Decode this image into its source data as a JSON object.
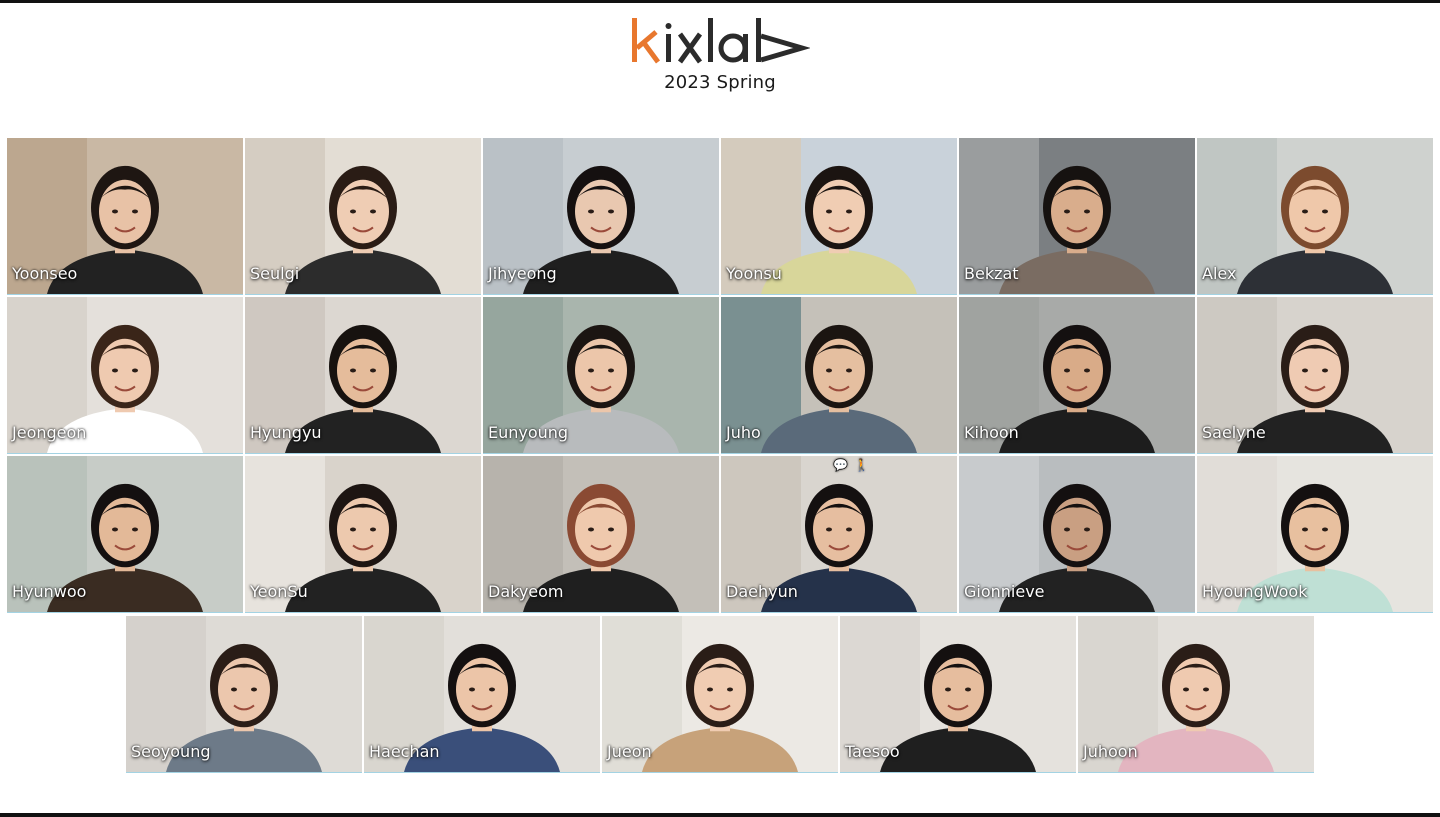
{
  "header": {
    "logo_text": "kixlab",
    "subtitle": "2023 Spring",
    "brand_orange": "#e8772e",
    "brand_dark": "#2b2b2b"
  },
  "participants": [
    {
      "name": "Yoonseo",
      "bg": "#c9b8a4",
      "wall": "#b79f86",
      "skin": "#e8c2a6",
      "hair": "#1e1612",
      "shirt": "#222222"
    },
    {
      "name": "Seulgi",
      "bg": "#e3ddd4",
      "wall": "#cfc6bb",
      "skin": "#efcdb4",
      "hair": "#2a1c15",
      "shirt": "#2c2c2c"
    },
    {
      "name": "Jihyeong",
      "bg": "#c7cdd1",
      "wall": "#b5bcc2",
      "skin": "#e9c8b0",
      "hair": "#151010",
      "shirt": "#1f1f1f"
    },
    {
      "name": "Yoonsu",
      "bg": "#c9d2da",
      "wall": "#d8c7b0",
      "skin": "#f0cdb3",
      "hair": "#1b1411",
      "shirt": "#d8d69a"
    },
    {
      "name": "Bekzat",
      "bg": "#7b7f82",
      "wall": "#a8aaa9",
      "skin": "#d9ad8c",
      "hair": "#161210",
      "shirt": "#7a6c62"
    },
    {
      "name": "Alex",
      "bg": "#cfd2cf",
      "wall": "#b9c1bd",
      "skin": "#efc8aa",
      "hair": "#7c4b2e",
      "shirt": "#2d3036"
    },
    {
      "name": "Jeongeon",
      "bg": "#e4e0db",
      "wall": "#d3cdc6",
      "skin": "#efcab0",
      "hair": "#3a2519",
      "shirt": "#ffffff"
    },
    {
      "name": "Hyungyu",
      "bg": "#dcd7d1",
      "wall": "#c9c2ba",
      "skin": "#e5bc9b",
      "hair": "#17120f",
      "shirt": "#222222"
    },
    {
      "name": "Eunyoung",
      "bg": "#a9b5ad",
      "wall": "#8fa097",
      "skin": "#ecc6aa",
      "hair": "#1b1512",
      "shirt": "#b8bbbd"
    },
    {
      "name": "Juho",
      "bg": "#c5c1b9",
      "wall": "#5a7a80",
      "skin": "#e5bfa0",
      "hair": "#1b1511",
      "shirt": "#5a6a7a"
    },
    {
      "name": "Kihoon",
      "bg": "#a8aaa8",
      "wall": "#9c9f9d",
      "skin": "#d9ab88",
      "hair": "#141010",
      "shirt": "#1d1d1d"
    },
    {
      "name": "Saelyne",
      "bg": "#d7d3cd",
      "wall": "#c9c4bd",
      "skin": "#efcbb3",
      "hair": "#2a1d17",
      "shirt": "#222222"
    },
    {
      "name": "Hyunwoo",
      "bg": "#c7ccc7",
      "wall": "#b4bdb6",
      "skin": "#e3b998",
      "hair": "#141010",
      "shirt": "#3a2c22"
    },
    {
      "name": "YeonSu",
      "bg": "#d9d3cb",
      "wall": "#ece9e4",
      "skin": "#edc9ae",
      "hair": "#1d1512",
      "shirt": "#222222"
    },
    {
      "name": "Dakyeom",
      "bg": "#c3bfb8",
      "wall": "#b2aea7",
      "skin": "#efc9ad",
      "hair": "#8a4a33",
      "shirt": "#1f1f1f"
    },
    {
      "name": "Daehyun",
      "bg": "#d9d5cf",
      "wall": "#c8c1b6",
      "skin": "#e6bea0",
      "hair": "#141010",
      "shirt": "#25324a"
    },
    {
      "name": "Gionnieve",
      "bg": "#b9bdbf",
      "wall": "#cfd2d3",
      "skin": "#c99f82",
      "hair": "#141010",
      "shirt": "#222222"
    },
    {
      "name": "HyoungWook",
      "bg": "#e6e4df",
      "wall": "#dedad4",
      "skin": "#e8c09f",
      "hair": "#141010",
      "shirt": "#bfe0d5"
    },
    {
      "name": "Seoyoung",
      "bg": "#dedbd6",
      "wall": "#d1cdc7",
      "skin": "#ecc7ad",
      "hair": "#2a1d17",
      "shirt": "#6d7a88"
    },
    {
      "name": "Haechan",
      "bg": "#e2dfda",
      "wall": "#d5d1cb",
      "skin": "#ecc5a8",
      "hair": "#141010",
      "shirt": "#3a4f7a"
    },
    {
      "name": "Jueon",
      "bg": "#ece9e4",
      "wall": "#dcd8d2",
      "skin": "#f0ccb2",
      "hair": "#2a1d17",
      "shirt": "#c7a27a"
    },
    {
      "name": "Taesoo",
      "bg": "#e5e2dd",
      "wall": "#d8d4ce",
      "skin": "#e6bd9e",
      "hair": "#141010",
      "shirt": "#1f1f1f"
    },
    {
      "name": "Juhoon",
      "bg": "#e2dfda",
      "wall": "#d6d2cc",
      "skin": "#efcab0",
      "hair": "#2a1d17",
      "shirt": "#e3b5c0"
    }
  ]
}
